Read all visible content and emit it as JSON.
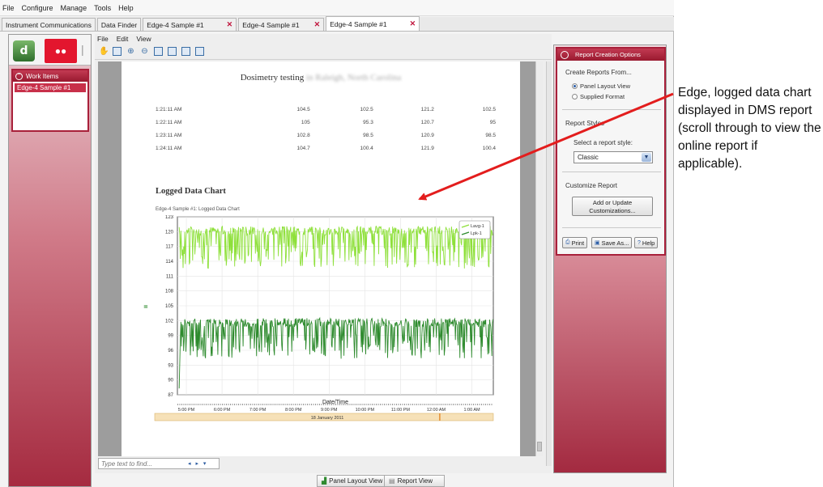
{
  "menubar": [
    "File",
    "Configure",
    "Manage",
    "Tools",
    "Help"
  ],
  "tabs": [
    {
      "label": "Instrument Communications",
      "close": false
    },
    {
      "label": "Data Finder",
      "close": false
    },
    {
      "label": "Edge-4 Sample #1",
      "close": true
    },
    {
      "label": "Edge-4 Sample #1",
      "close": true
    },
    {
      "label": "Edge-4 Sample #1",
      "close": true,
      "active": true
    }
  ],
  "left": {
    "work_items_title": "Work Items",
    "work_item": "Edge-4 Sample #1"
  },
  "doc": {
    "menu": [
      "File",
      "Edit",
      "View"
    ],
    "title_visible": "Dosimetry testing",
    "title_blurred": "in Raleigh, North Carolina",
    "table": [
      [
        "1:21:11 AM",
        "104.5",
        "102.5",
        "121.2",
        "102.5"
      ],
      [
        "1:22:11 AM",
        "105",
        "95.3",
        "120.7",
        "95"
      ],
      [
        "1:23:11 AM",
        "102.8",
        "98.5",
        "120.9",
        "98.5"
      ],
      [
        "1:24:11 AM",
        "104.7",
        "100.4",
        "121.9",
        "100.4"
      ]
    ],
    "chart_heading": "Logged Data Chart",
    "chart_subtitle": "Edge-4 Sample #1: Logged Data Chart",
    "find_placeholder": "Type text to find...",
    "find_nav": "◂ ▸ ▾"
  },
  "chart_data": {
    "type": "line",
    "title": "",
    "xlabel": "Date/Time",
    "ylabel": "",
    "ylim": [
      87,
      123
    ],
    "yticks": [
      87,
      90,
      93,
      96,
      99,
      102,
      105,
      108,
      111,
      114,
      117,
      120,
      123
    ],
    "xticks": [
      "5:00 PM",
      "6:00 PM",
      "7:00 PM",
      "8:00 PM",
      "9:00 PM",
      "10:00 PM",
      "11:00 PM",
      "12:00 AM",
      "1:00 AM"
    ],
    "xrange_hours": [
      16.75,
      25.6
    ],
    "date_label": "18 January 2011",
    "legend_position": "top-right",
    "series": [
      {
        "name": "Lavg-1",
        "color": "#8ee03a",
        "base": 120.2,
        "dip_min": 112.5
      },
      {
        "name": "Lpk-1",
        "color": "#2e8b2e",
        "base": 101.6,
        "dip_min": 94.2
      }
    ]
  },
  "right": {
    "title": "Report Creation Options",
    "create_from": "Create Reports From...",
    "options": [
      "Panel Layout View",
      "Supplied Format"
    ],
    "selected_option": "Panel Layout View",
    "styles_label": "Report Styles",
    "select_style_label": "Select a report style:",
    "style_value": "Classic",
    "customize_label": "Customize Report",
    "add_update_line1": "Add or Update",
    "add_update_line2": "Customizations...",
    "print": "Print",
    "save_as": "Save As...",
    "help": "Help"
  },
  "bottom": {
    "panel_layout_view": "Panel Layout View",
    "report_view": "Report View"
  },
  "annotation": "Edge, logged data chart displayed in DMS report (scroll through to view the online report if applicable).",
  "colors": {
    "accent": "#a8203a",
    "arrow": "#e31d1d"
  }
}
